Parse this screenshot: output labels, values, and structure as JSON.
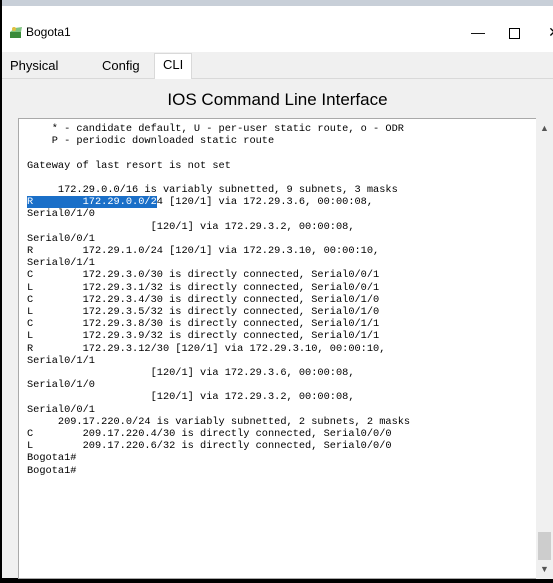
{
  "window": {
    "title": "Bogota1",
    "minimize_glyph": "—",
    "close_glyph": "✕"
  },
  "tabs": [
    {
      "label": "Physical"
    },
    {
      "label": "Config"
    },
    {
      "label": "CLI"
    }
  ],
  "cli": {
    "heading": "IOS Command Line Interface",
    "highlighted_route": "172.29.0.0/2",
    "lines": [
      "    * - candidate default, U - per-user static route, o - ODR",
      "    P - periodic downloaded static route",
      "",
      "Gateway of last resort is not set",
      "",
      "     172.29.0.0/16 is variably subnetted, 9 subnets, 3 masks",
      "__R__HL__4 [120/1] via 172.29.3.6, 00:00:08,",
      "Serial0/1/0",
      "                    [120/1] via 172.29.3.2, 00:00:08,",
      "Serial0/0/1",
      "R        172.29.1.0/24 [120/1] via 172.29.3.10, 00:00:10,",
      "Serial0/1/1",
      "C        172.29.3.0/30 is directly connected, Serial0/0/1",
      "L        172.29.3.1/32 is directly connected, Serial0/0/1",
      "C        172.29.3.4/30 is directly connected, Serial0/1/0",
      "L        172.29.3.5/32 is directly connected, Serial0/1/0",
      "C        172.29.3.8/30 is directly connected, Serial0/1/1",
      "L        172.29.3.9/32 is directly connected, Serial0/1/1",
      "R        172.29.3.12/30 [120/1] via 172.29.3.10, 00:00:10,",
      "Serial0/1/1",
      "                    [120/1] via 172.29.3.6, 00:00:08,",
      "Serial0/1/0",
      "                    [120/1] via 172.29.3.2, 00:00:08,",
      "Serial0/0/1",
      "     209.17.220.0/24 is variably subnetted, 2 subnets, 2 masks",
      "C        209.17.220.4/30 is directly connected, Serial0/0/0",
      "L        209.17.220.6/32 is directly connected, Serial0/0/0",
      "Bogota1#",
      "Bogota1#"
    ]
  },
  "icons": {
    "app": "router-icon",
    "scroll_up": "chevron-up-icon",
    "scroll_down": "chevron-down-icon"
  }
}
